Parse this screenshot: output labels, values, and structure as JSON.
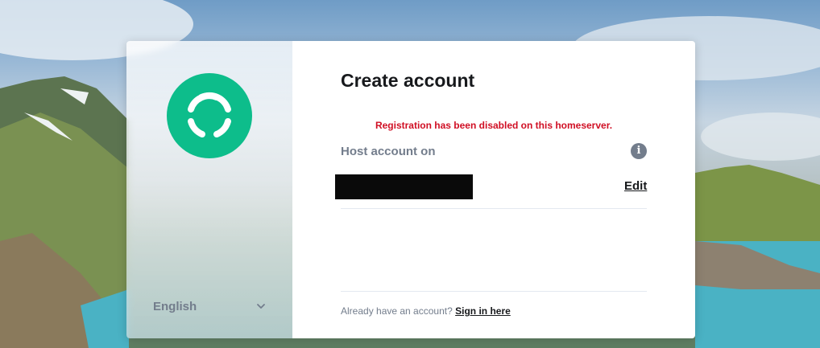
{
  "colors": {
    "brand_green": "#0dbd8b",
    "error_red": "#d00f24",
    "heading": "#17191c",
    "muted": "#737d8c"
  },
  "sidebar": {
    "logo_icon": "element-logo-icon",
    "language": {
      "selected": "English",
      "chevron_icon": "chevron-down-icon"
    }
  },
  "main": {
    "title": "Create account",
    "error_message": "Registration has been disabled on this homeserver.",
    "host_label": "Host account on",
    "info_icon": "info-icon",
    "server_name": "",
    "edit_label": "Edit",
    "footer": {
      "prompt": "Already have an account?",
      "link": "Sign in here"
    }
  }
}
